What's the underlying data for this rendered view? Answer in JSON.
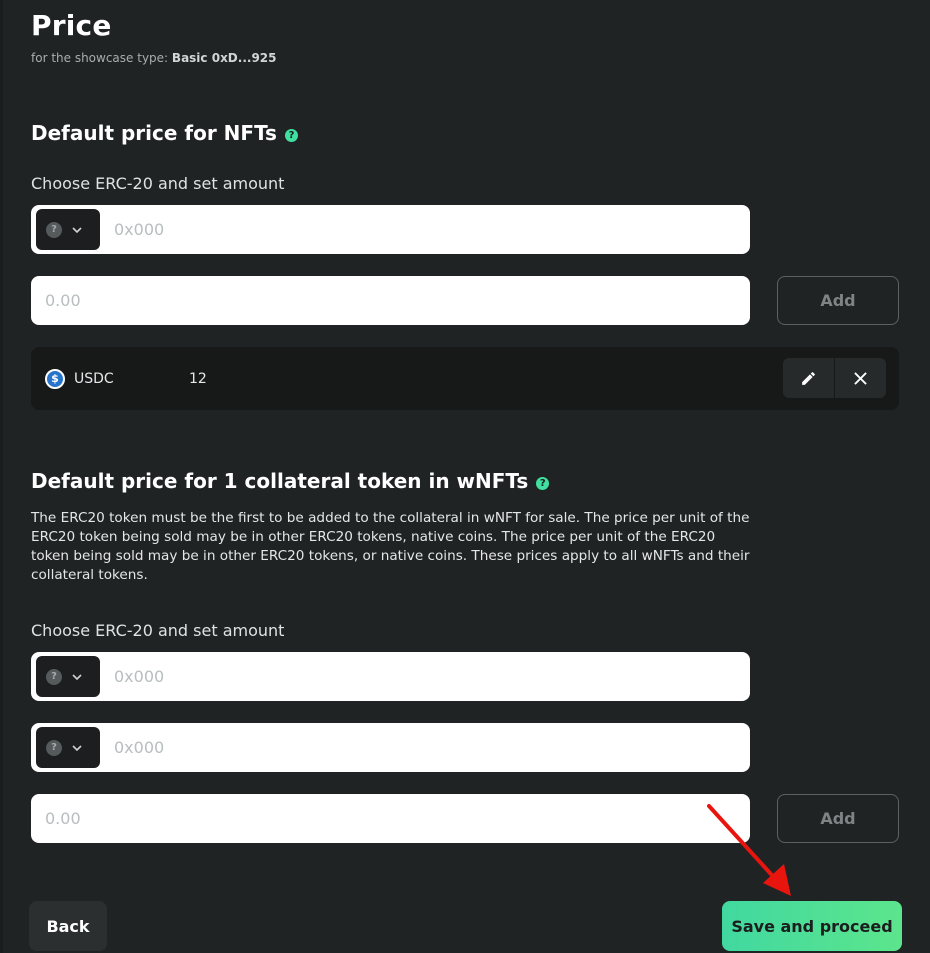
{
  "header": {
    "title": "Price",
    "subtitle_prefix": "for the showcase type:",
    "showcase_type": "Basic 0xD...925"
  },
  "nft_section": {
    "title": "Default price for NFTs",
    "help_icon": "help-icon",
    "choose_label": "Choose ERC-20 and set amount",
    "token_selector": {
      "icon": "question-circle-icon",
      "glyph": "?"
    },
    "address_placeholder": "0x000",
    "amount_placeholder": "0.00",
    "add_label": "Add",
    "prices": [
      {
        "token": "USDC",
        "amount": "12",
        "icon": "usdc-icon"
      }
    ]
  },
  "collateral_section": {
    "title": "Default price for 1 collateral token in wNFTs",
    "help_icon": "help-icon",
    "description": "The ERC20 token must be the first to be added to the collateral in wNFT for sale. The price per unit of the ERC20 token being sold may be in other ERC20 tokens, native coins. The price per unit of the ERC20 token being sold may be in other ERC20 tokens, or native coins. These prices apply to all wNFTs and their collateral tokens.",
    "choose_label": "Choose ERC-20 and set amount",
    "address_placeholder_1": "0x000",
    "address_placeholder_2": "0x000",
    "amount_placeholder": "0.00",
    "add_label": "Add"
  },
  "footer": {
    "back_label": "Back",
    "save_label": "Save and proceed"
  },
  "colors": {
    "background": "#202324",
    "accent": "#41d8a0",
    "annotation_arrow": "#e8150e"
  }
}
